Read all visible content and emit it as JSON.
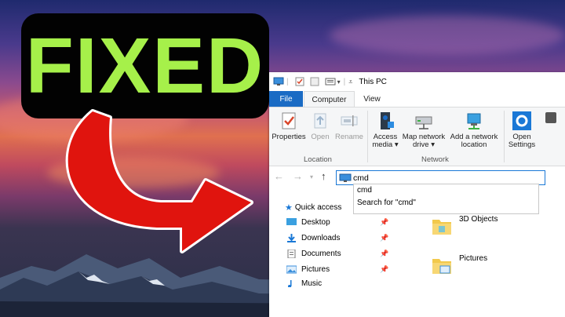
{
  "badge": {
    "text": "FIXED"
  },
  "window": {
    "title": "This PC",
    "tabs": [
      {
        "label": "File"
      },
      {
        "label": "Computer"
      },
      {
        "label": "View"
      }
    ],
    "ribbon": {
      "location": {
        "label": "Location",
        "buttons": [
          {
            "label": "Properties"
          },
          {
            "label": "Open"
          },
          {
            "label": "Rename"
          }
        ]
      },
      "network": {
        "label": "Network",
        "buttons": [
          {
            "line1": "Access",
            "line2": "media ▾"
          },
          {
            "line1": "Map network",
            "line2": "drive ▾"
          },
          {
            "line1": "Add a network",
            "line2": "location"
          }
        ]
      },
      "system": {
        "buttons": [
          {
            "line1": "Open",
            "line2": "Settings"
          }
        ]
      }
    },
    "address": {
      "value": "cmd"
    },
    "dropdown": {
      "items": [
        "cmd",
        "Search for \"cmd\""
      ]
    },
    "nav_pane": {
      "quick_access": "Quick access",
      "items": [
        "Desktop",
        "Downloads",
        "Documents",
        "Pictures",
        "Music"
      ]
    },
    "content": {
      "items": [
        "3D Objects",
        "Pictures"
      ]
    }
  },
  "colors": {
    "badge_text": "#a6f04a",
    "file_tab": "#1a6bc4",
    "arrow_red": "#e0140e"
  }
}
